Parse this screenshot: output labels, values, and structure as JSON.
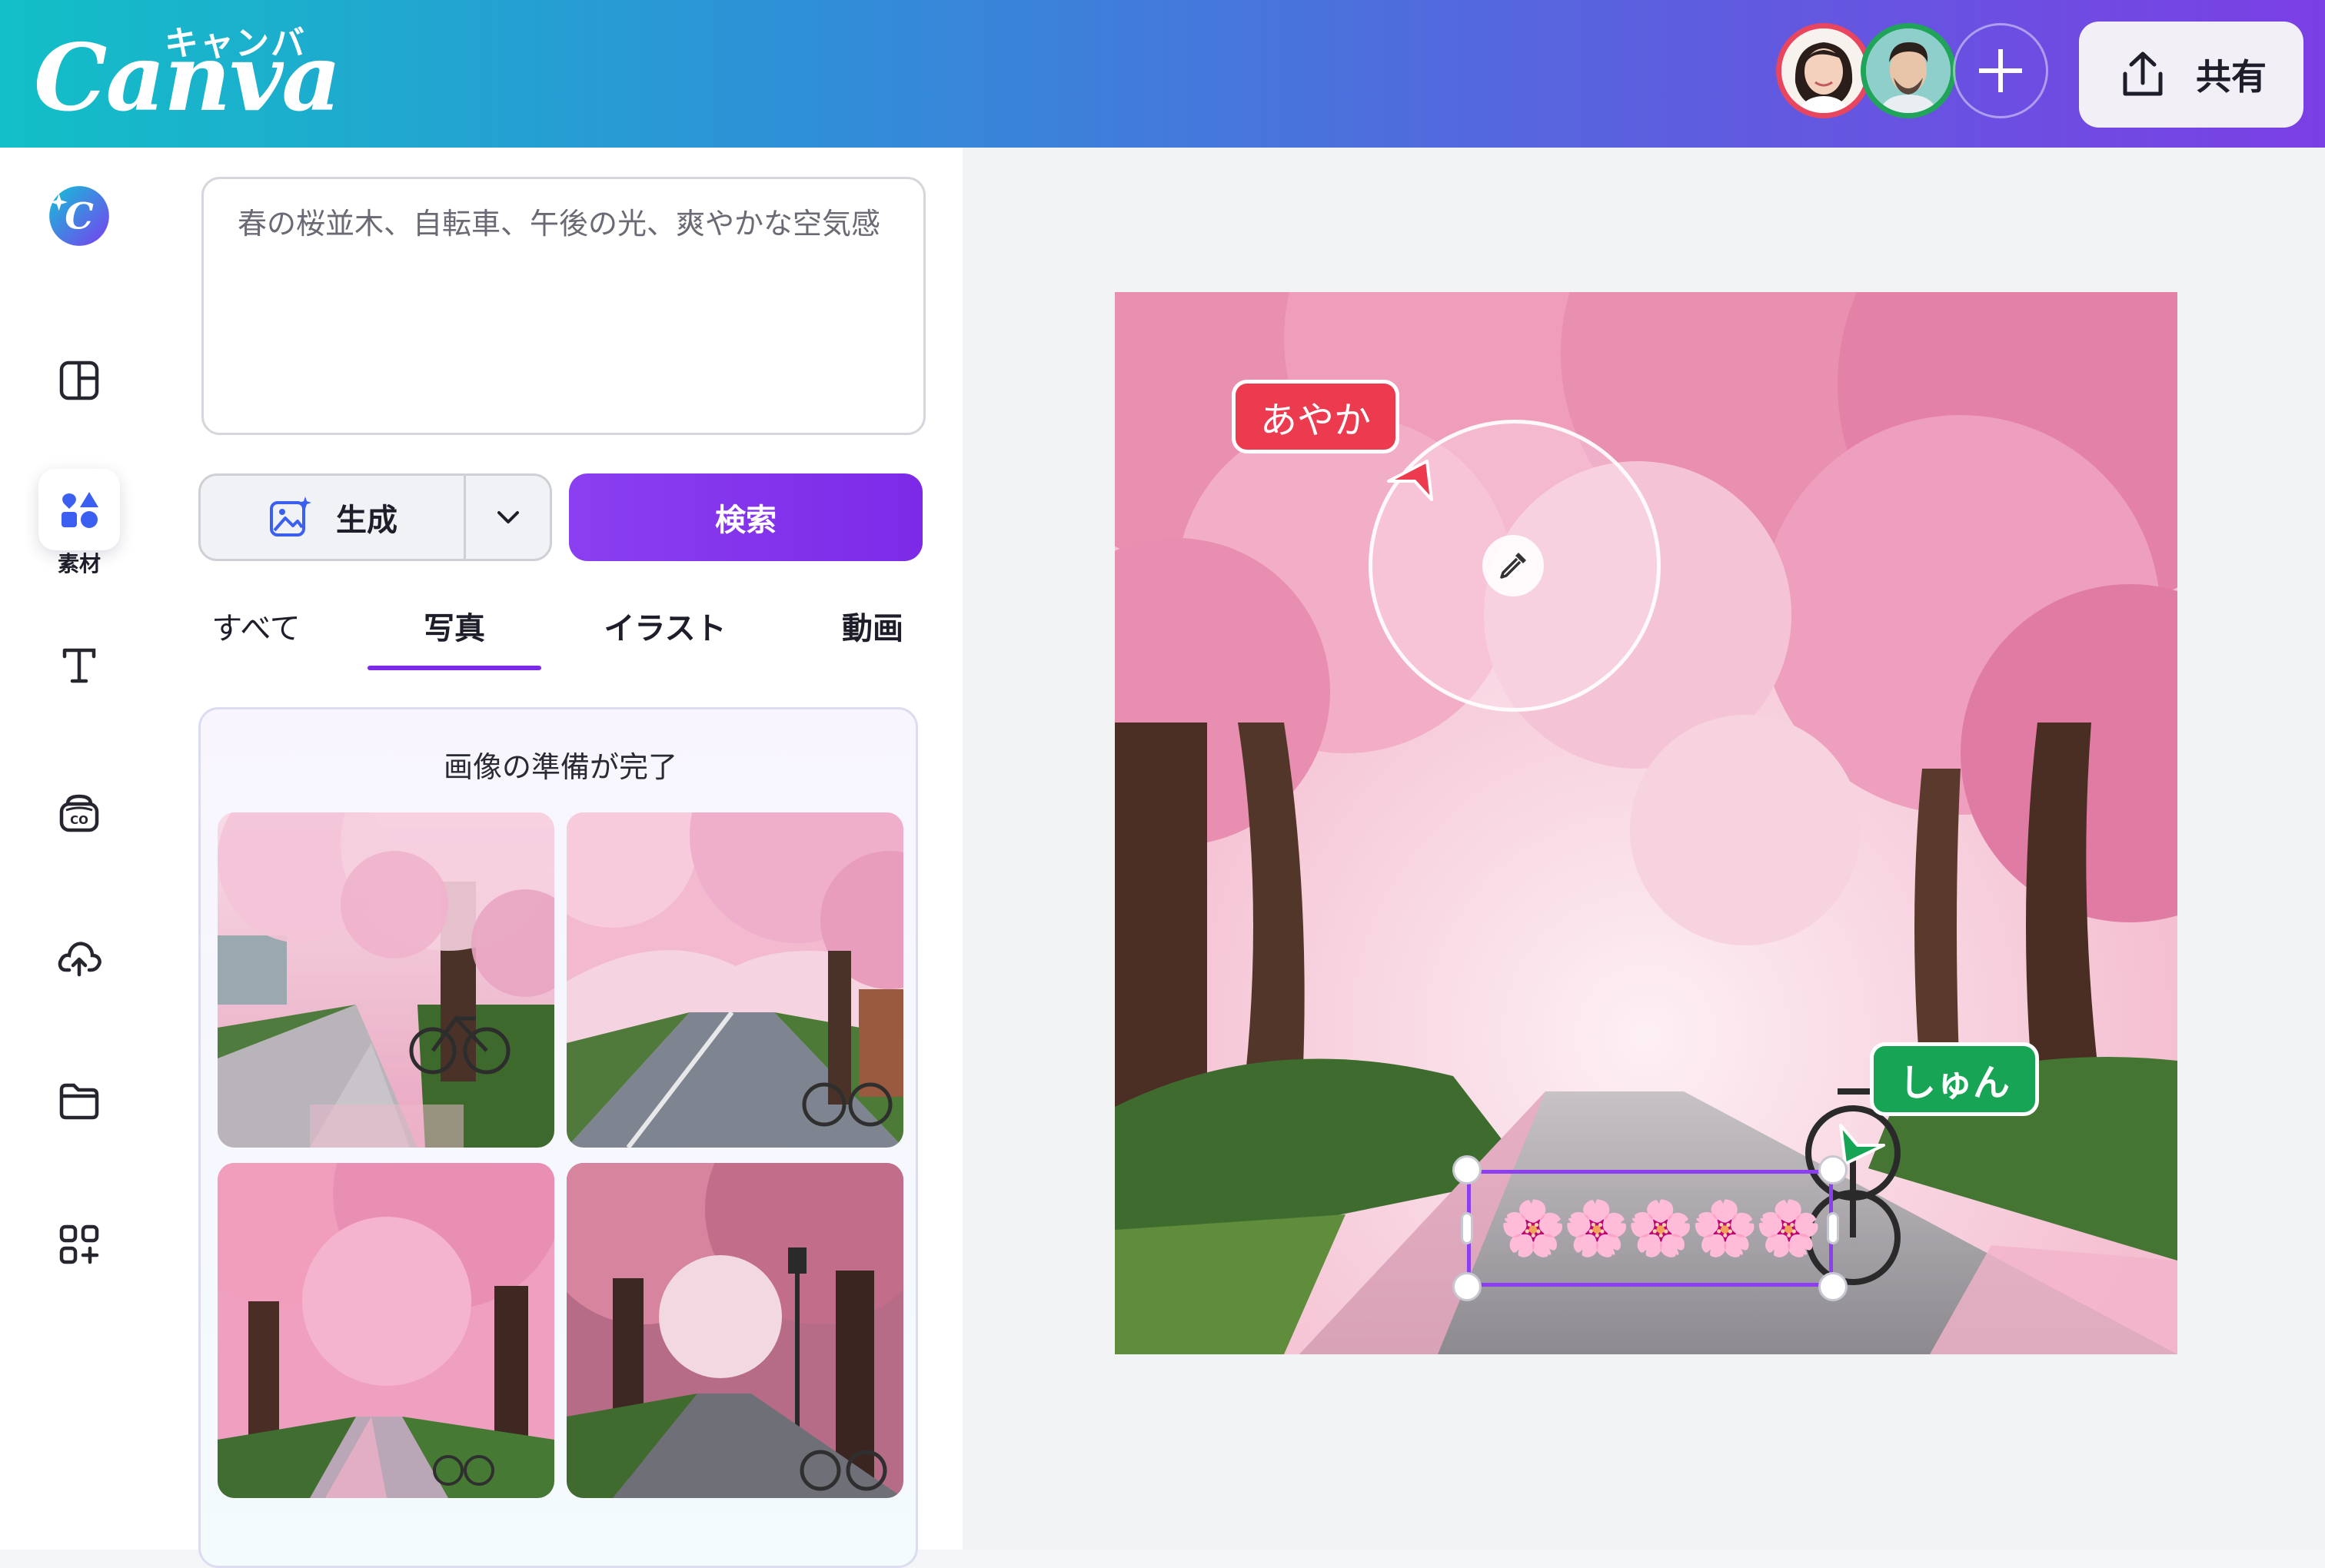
{
  "header": {
    "logo_word": "Canva",
    "logo_kana": "キャンバ",
    "share_label": "共有",
    "gradient": [
      "#12bfc7",
      "#5566de",
      "#7b3fe4"
    ]
  },
  "rail": {
    "active_label": "素材",
    "items": [
      "canva-ai",
      "design",
      "elements",
      "text",
      "brand",
      "uploads",
      "projects",
      "apps"
    ]
  },
  "panel": {
    "prompt_text": "春の桜並木、自転車、午後の光、爽やかな空気感",
    "generate_label": "生成",
    "search_label": "検索",
    "tabs": [
      {
        "label": "すべて",
        "active": false
      },
      {
        "label": "写真",
        "active": true
      },
      {
        "label": "イラスト",
        "active": false
      },
      {
        "label": "動画",
        "active": false
      }
    ],
    "results_title": "画像の準備が完了"
  },
  "canvas": {
    "collaborator_a": "あやか",
    "collaborator_b": "しゅん",
    "selected_text": "🌸🌸🌸🌸🌸"
  },
  "colors": {
    "accent": "#7d2ae8",
    "collaborator_a": "#ec3b4f",
    "collaborator_b": "#17a455"
  }
}
